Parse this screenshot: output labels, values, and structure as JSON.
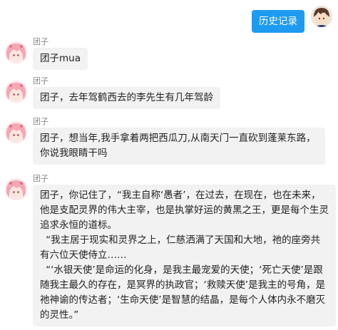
{
  "header": {
    "history_button_label": "历史记录"
  },
  "colors": {
    "accent": "#1e9bf0",
    "bubble_bg": "#f2f2f2",
    "sender_name": "#888888"
  },
  "messages": [
    {
      "sender": "团子",
      "paragraphs": [
        "团子mua"
      ]
    },
    {
      "sender": "团子",
      "paragraphs": [
        "团子，去年驾鹤西去的李先生有几年驾龄"
      ]
    },
    {
      "sender": "团子",
      "paragraphs": [
        "团子，想当年,我手拿着两把西瓜刀,从南天门一直砍到蓬莱东路，你说我眼睛干吗"
      ]
    },
    {
      "sender": "团子",
      "paragraphs": [
        "团子，你记住了，“我主自称‘愚者’，在过去，在现在，也在未来，他是支配灵界的伟大主宰，也是执掌好运的黄黑之王，更是每个生灵追求永恒的道标。",
        "“我主居于现实和灵界之上，仁慈洒满了天国和大地，祂的座旁共有六位天使侍立……",
        "“‘水银天使’是命运的化身，是我主最宠爱的天使；‘死亡天使’是跟随我主最久的存在，是冥界的执政官；‘救赎天使’是我主的号角，是祂神谕的传达者；‘生命天使’是智慧的结晶，是每个人体内永不磨灭的灵性。”"
      ]
    }
  ]
}
